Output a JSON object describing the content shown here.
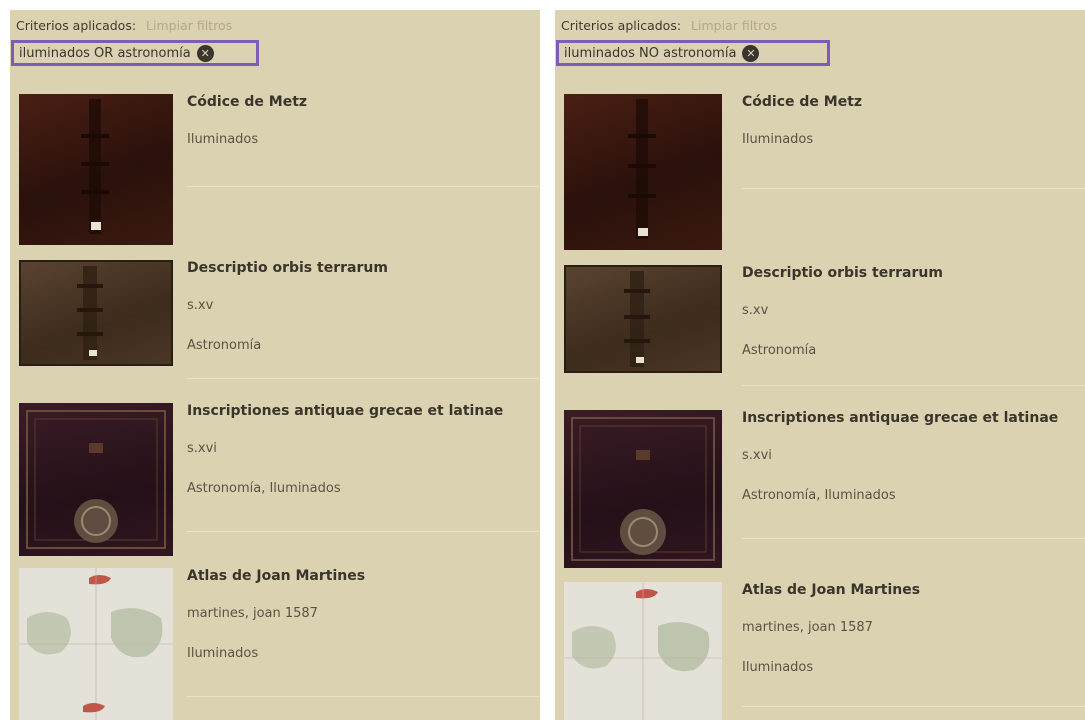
{
  "criteria_label": "Criterios aplicados:",
  "clear_filters": "Limpiar filtros",
  "left": {
    "filter": "iluminados OR astronomía",
    "results": [
      {
        "title": "Códice de Metz",
        "lines": [
          "Iluminados"
        ]
      },
      {
        "title": "Descriptio orbis terrarum",
        "lines": [
          "s.xv",
          "Astronomía"
        ]
      },
      {
        "title": "Inscriptiones antiquae grecae et latinae",
        "lines": [
          "s.xvi",
          "Astronomía, Iluminados"
        ]
      },
      {
        "title": "Atlas de Joan Martines",
        "lines": [
          "martines, joan 1587",
          "Iluminados"
        ]
      }
    ]
  },
  "right": {
    "filter": "iluminados NO astronomía",
    "results": [
      {
        "title": "Códice de Metz",
        "lines": [
          "Iluminados"
        ]
      },
      {
        "title": "Descriptio orbis terrarum",
        "lines": [
          "s.xv",
          "Astronomía"
        ]
      },
      {
        "title": "Inscriptiones antiquae grecae et latinae",
        "lines": [
          "s.xvi",
          "Astronomía, Iluminados"
        ]
      },
      {
        "title": "Atlas de Joan Martines",
        "lines": [
          "martines, joan 1587",
          "Iluminados"
        ]
      }
    ]
  },
  "icons": {
    "remove_filter": "close-circle-icon"
  },
  "colors": {
    "background": "#dbd2b1",
    "highlight_border": "#7d5bb6",
    "clear_link": "#b3a985",
    "text": "#3a352b"
  }
}
